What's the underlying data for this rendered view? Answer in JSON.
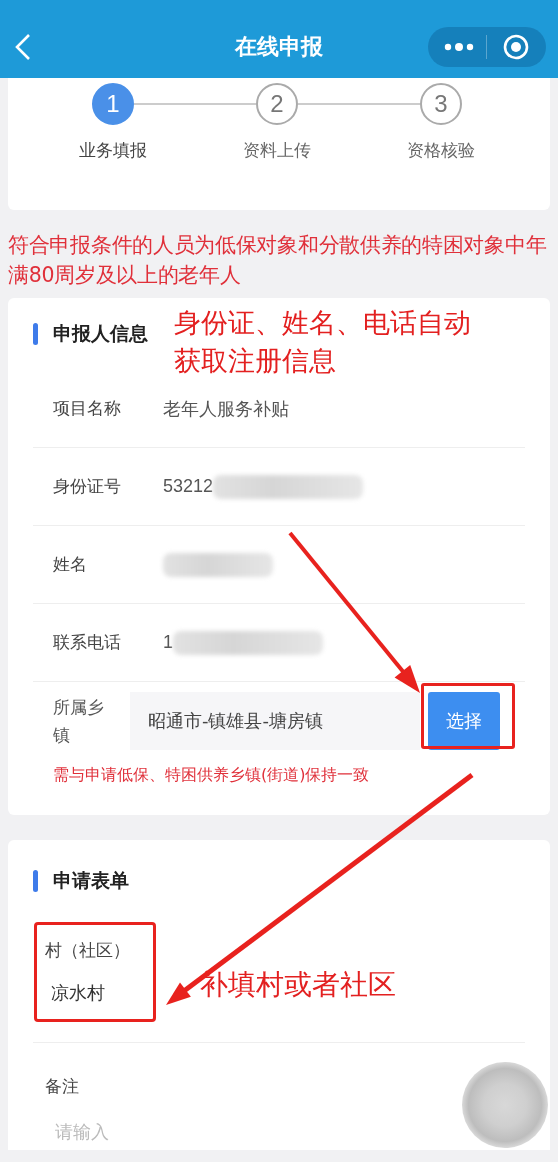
{
  "header": {
    "title": "在线申报"
  },
  "steps": [
    {
      "number": "1",
      "label": "业务填报",
      "selected": true
    },
    {
      "number": "2",
      "label": "资料上传",
      "selected": false
    },
    {
      "number": "3",
      "label": "资格核验",
      "selected": false
    }
  ],
  "notice": "符合申报条件的人员为低保对象和分散供养的特困对象中年满80周岁及以上的老年人",
  "applicant": {
    "title": "申报人信息",
    "annotation": "身份证、姓名、电话自动获取注册信息",
    "rows": [
      {
        "label": "项目名称",
        "value": "老年人服务补贴",
        "redacted": false
      },
      {
        "label": "身份证号",
        "value": "53212",
        "redacted": true
      },
      {
        "label": "姓名",
        "redacted": true
      },
      {
        "label": "联系电话",
        "value": "1",
        "redacted": true
      }
    ],
    "town": {
      "label": "所属乡镇",
      "value": "昭通市-镇雄县-塘房镇",
      "button": "选择"
    },
    "hint": "需与申请低保、特困供养乡镇(街道)保持一致"
  },
  "form": {
    "title": "申请表单",
    "village_label": "村（社区）",
    "village_value": "凉水村",
    "annotation": "补填村或者社区",
    "remark_label": "备注",
    "remark_placeholder": "请输入"
  }
}
